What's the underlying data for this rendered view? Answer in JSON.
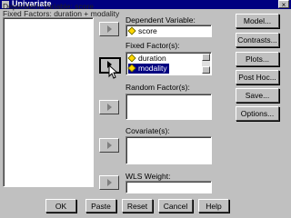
{
  "window": {
    "title": "Univariate",
    "close_glyph": "×"
  },
  "ghost_lines": [
    "Dependent Variable: score",
    "Fixed Factors: duration + modality"
  ],
  "dependent": {
    "label": "Dependent Variable:",
    "value": "score"
  },
  "fixed": {
    "label": "Fixed Factor(s):",
    "items": [
      "duration",
      "modality"
    ],
    "selected": "modality"
  },
  "random": {
    "label": "Random Factor(s):"
  },
  "covariate": {
    "label": "Covariate(s):"
  },
  "wls": {
    "label": "WLS Weight:"
  },
  "side_buttons": [
    "Model...",
    "Contrasts...",
    "Plots...",
    "Post Hoc...",
    "Save...",
    "Options..."
  ],
  "bottom_buttons": [
    "OK",
    "Paste",
    "Reset",
    "Cancel",
    "Help"
  ]
}
